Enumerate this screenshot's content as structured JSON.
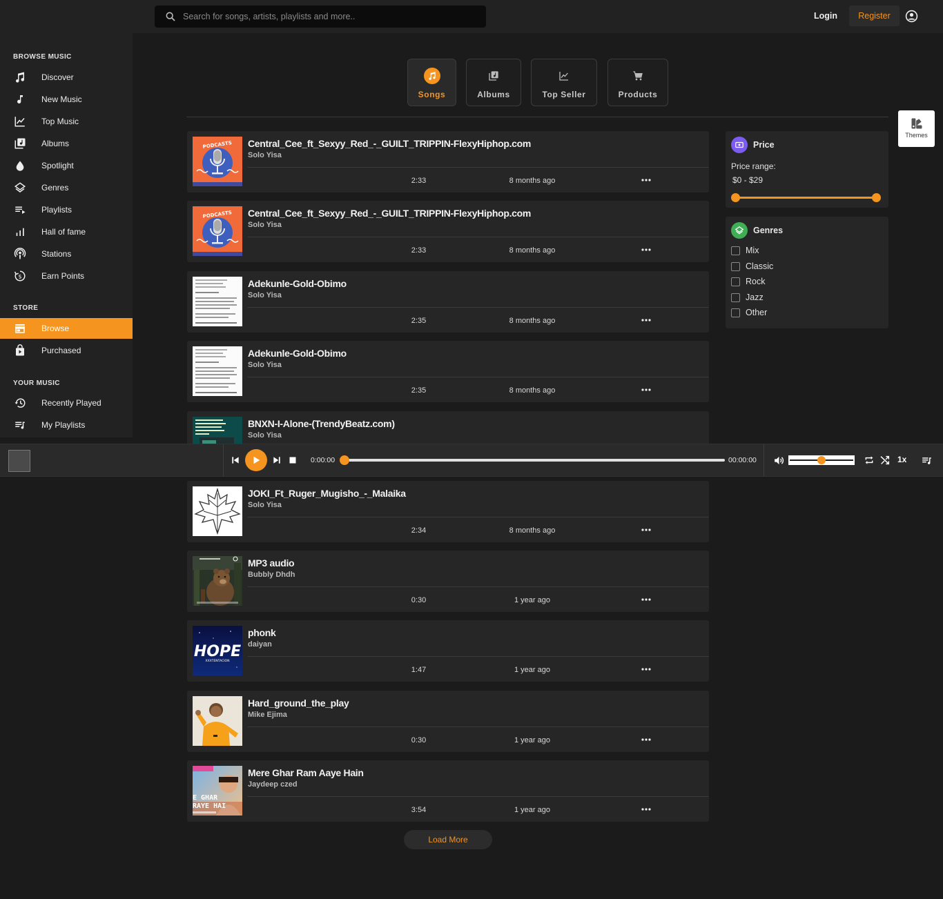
{
  "sidebar": {
    "browse_title": "BROWSE MUSIC",
    "browse": [
      {
        "label": "Discover",
        "icon": "music-note-icon"
      },
      {
        "label": "New Music",
        "icon": "single-note-icon"
      },
      {
        "label": "Top Music",
        "icon": "line-chart-icon"
      },
      {
        "label": "Albums",
        "icon": "album-library-icon"
      },
      {
        "label": "Spotlight",
        "icon": "drop-icon"
      },
      {
        "label": "Genres",
        "icon": "layers-icon"
      },
      {
        "label": "Playlists",
        "icon": "playlist-icon"
      },
      {
        "label": "Hall of fame",
        "icon": "bar-chart-icon"
      },
      {
        "label": "Stations",
        "icon": "podcast-icon"
      },
      {
        "label": "Earn Points",
        "icon": "points-icon"
      }
    ],
    "store_title": "STORE",
    "store": [
      {
        "label": "Browse",
        "icon": "storefront-icon"
      },
      {
        "label": "Purchased",
        "icon": "shopping-bag-icon"
      }
    ],
    "your_title": "YOUR MUSIC",
    "your": [
      {
        "label": "Recently Played",
        "icon": "history-icon"
      },
      {
        "label": "My Playlists",
        "icon": "my-playlist-icon"
      }
    ]
  },
  "header": {
    "search_placeholder": "Search for songs, artists, playlists and more..",
    "login": "Login",
    "register": "Register"
  },
  "tabs": [
    {
      "label": "Songs",
      "active": true
    },
    {
      "label": "Albums",
      "active": false
    },
    {
      "label": "Top Seller",
      "active": false
    },
    {
      "label": "Products",
      "active": false
    }
  ],
  "themes_label": "Themes",
  "songs": [
    {
      "title": "Central_Cee_ft_Sexyy_Red_-_GUILT_TRIPPIN-FlexyHiphop.com",
      "artist": "Solo Yisa",
      "duration": "2:33",
      "age": "8 months ago",
      "thumb": "podcast-mic"
    },
    {
      "title": "Central_Cee_ft_Sexyy_Red_-_GUILT_TRIPPIN-FlexyHiphop.com",
      "artist": "Solo Yisa",
      "duration": "2:33",
      "age": "8 months ago",
      "thumb": "podcast-mic"
    },
    {
      "title": "Adekunle-Gold-Obimo",
      "artist": "Solo Yisa",
      "duration": "2:35",
      "age": "8 months ago",
      "thumb": "text-doc"
    },
    {
      "title": "Adekunle-Gold-Obimo",
      "artist": "Solo Yisa",
      "duration": "2:35",
      "age": "8 months ago",
      "thumb": "text-doc"
    },
    {
      "title": "BNXN-I-Alone-(TrendyBeatz.com)",
      "artist": "Solo Yisa",
      "duration": "",
      "age": "",
      "thumb": "teal-doc"
    },
    {
      "title": "JOKI_Ft_Ruger_Mugisho_-_Malaika",
      "artist": "Solo Yisa",
      "duration": "2:34",
      "age": "8 months ago",
      "thumb": "leaf"
    },
    {
      "title": "MP3 audio",
      "artist": "Bubbly Dhdh",
      "duration": "0:30",
      "age": "1 year ago",
      "thumb": "bear"
    },
    {
      "title": "phonk",
      "artist": "daiyan",
      "duration": "1:47",
      "age": "1 year ago",
      "thumb": "hope"
    },
    {
      "title": "Hard_ground_the_play",
      "artist": "Mike Ejima",
      "duration": "0:30",
      "age": "1 year ago",
      "thumb": "yellow-person"
    },
    {
      "title": "Mere Ghar Ram Aaye Hain",
      "artist": "Jaydeep czed",
      "duration": "3:54",
      "age": "1 year ago",
      "thumb": "ghar"
    }
  ],
  "thumb_text": {
    "podcast": "PODCASTS",
    "hope": "HOPE",
    "hope_sub": "XXXTENTACION",
    "ghar1": "E GHAR",
    "ghar2": "RAYE HAI"
  },
  "filters": {
    "price_title": "Price",
    "range_label": "Price range:",
    "range_value": "$0 - $29",
    "range_min_fraction": 0,
    "range_max_fraction": 1,
    "genres_title": "Genres",
    "genres": [
      "Mix",
      "Classic",
      "Rock",
      "Jazz",
      "Other"
    ]
  },
  "player": {
    "current_time": "0:00:00",
    "total_time": "00:00:00",
    "progress_fraction": 0,
    "volume_fraction": 0.5,
    "speed": "1x"
  },
  "load_more": "Load More",
  "colors": {
    "accent": "#f5941e",
    "price_icon": "#7c5cf0",
    "genres_icon": "#3fae55"
  }
}
